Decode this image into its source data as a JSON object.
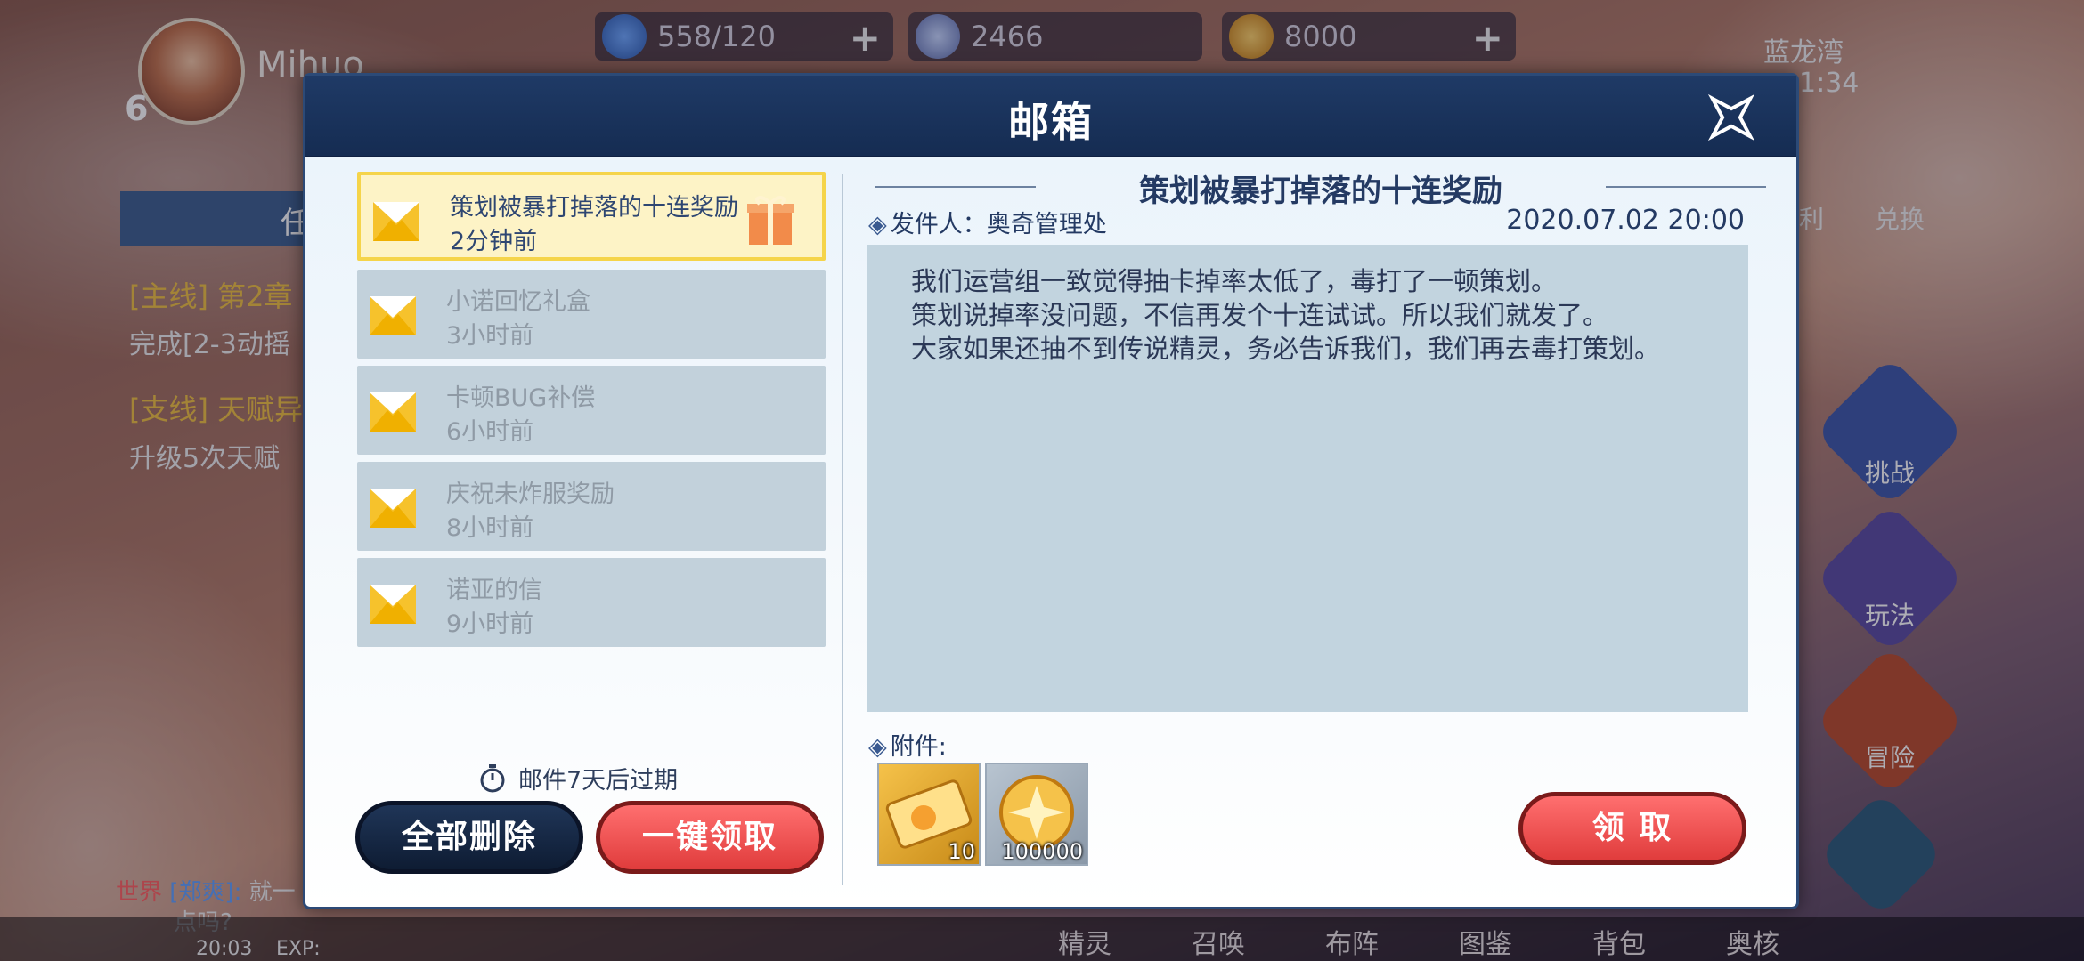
{
  "hud": {
    "player_level": "6",
    "player_name": "Mihuo",
    "stamina": "558/120",
    "gems": "2466",
    "coins": "8000",
    "location": "蓝龙湾",
    "clock": "1:34",
    "task_tab": "任",
    "main_quest": "[主线] 第2章",
    "main_quest_desc": "完成[2-3动摇",
    "side_quest": "[支线] 天赋异",
    "side_quest_desc": "升级5次天赋",
    "tab_welfare": "利",
    "tab_exchange": "兑换",
    "btn_challenge": "挑战",
    "btn_play": "玩法",
    "btn_adventure": "冒险",
    "chat_channel": "世界",
    "chat_user": "[郑爽]:",
    "chat_text": "就一",
    "chat_text2": "点吗?",
    "status_time": "20:03",
    "status_exp": "EXP:",
    "bottom_tabs": [
      "精灵",
      "召唤",
      "布阵",
      "图鉴",
      "背包",
      "奥核"
    ],
    "colors": {
      "accent_red": "#e03c3c",
      "header_navy": "#152c52",
      "selected_yellow": "#f5d44a"
    }
  },
  "dialog": {
    "title": "邮箱",
    "close_icon": "close-x-icon",
    "mails": [
      {
        "title": "策划被暴打掉落的十连奖励",
        "time": "2分钟前",
        "active": true,
        "has_gift": true
      },
      {
        "title": "小诺回忆礼盒",
        "time": "3小时前",
        "active": false
      },
      {
        "title": "卡顿BUG补偿",
        "time": "6小时前",
        "active": false
      },
      {
        "title": "庆祝未炸服奖励",
        "time": "8小时前",
        "active": false
      },
      {
        "title": "诺亚的信",
        "time": "9小时前",
        "active": false
      }
    ],
    "expire_note": "邮件7天后过期",
    "delete_all": "全部删除",
    "claim_all": "一键领取",
    "detail": {
      "title": "策划被暴打掉落的十连奖励",
      "sender_label": "发件人：",
      "sender": "奥奇管理处",
      "date": "2020.07.02  20:00",
      "body": [
        "我们运营组一致觉得抽卡掉率太低了，毒打了一顿策划。",
        "策划说掉率没问题，不信再发个十连试试。所以我们就发了。",
        "大家如果还抽不到传说精灵，务必告诉我们，我们再去毒打策划。"
      ],
      "attach_label": "附件:",
      "attachments": [
        {
          "icon": "summon-ticket-icon",
          "count": "10"
        },
        {
          "icon": "gold-coin-icon",
          "count": "100000"
        }
      ],
      "claim": "领 取"
    }
  }
}
